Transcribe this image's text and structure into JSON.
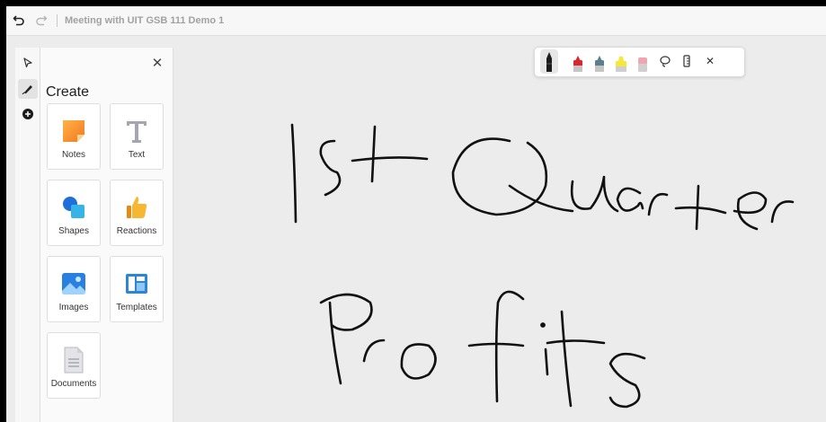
{
  "topbar": {
    "undo_icon": "undo-icon",
    "redo_icon": "redo-icon",
    "title": "Meeting with UIT GSB 111 Demo 1"
  },
  "toolrail": {
    "items": [
      {
        "name": "select-tool",
        "icon": "cursor-icon"
      },
      {
        "name": "ink-tool",
        "icon": "pen-icon",
        "active": true
      },
      {
        "name": "create-tool",
        "icon": "plus-circle-icon"
      }
    ]
  },
  "panel": {
    "title": "Create",
    "close_icon": "close-icon",
    "tiles": [
      {
        "label": "Notes",
        "icon": "notes-icon"
      },
      {
        "label": "Text",
        "icon": "text-icon"
      },
      {
        "label": "Shapes",
        "icon": "shapes-icon"
      },
      {
        "label": "Reactions",
        "icon": "thumbs-up-icon"
      },
      {
        "label": "Images",
        "icon": "image-icon"
      },
      {
        "label": "Templates",
        "icon": "templates-icon"
      },
      {
        "label": "Documents",
        "icon": "document-icon"
      }
    ]
  },
  "pen_tray": {
    "pens": [
      {
        "name": "black-pen",
        "color": "#1c1c1c",
        "selected": true
      },
      {
        "name": "red-pen",
        "color": "#d9272e"
      },
      {
        "name": "teal-pen",
        "color": "#5b7f8c"
      },
      {
        "name": "yellow-highlighter",
        "color": "#f4e83c"
      },
      {
        "name": "eraser",
        "color": "#f0a6b0"
      }
    ],
    "tools": [
      "lasso-icon",
      "ruler-icon",
      "close-icon"
    ]
  },
  "canvas": {
    "ink_color": "#111111",
    "handwriting": [
      "1st Quarter",
      "Profits"
    ]
  }
}
